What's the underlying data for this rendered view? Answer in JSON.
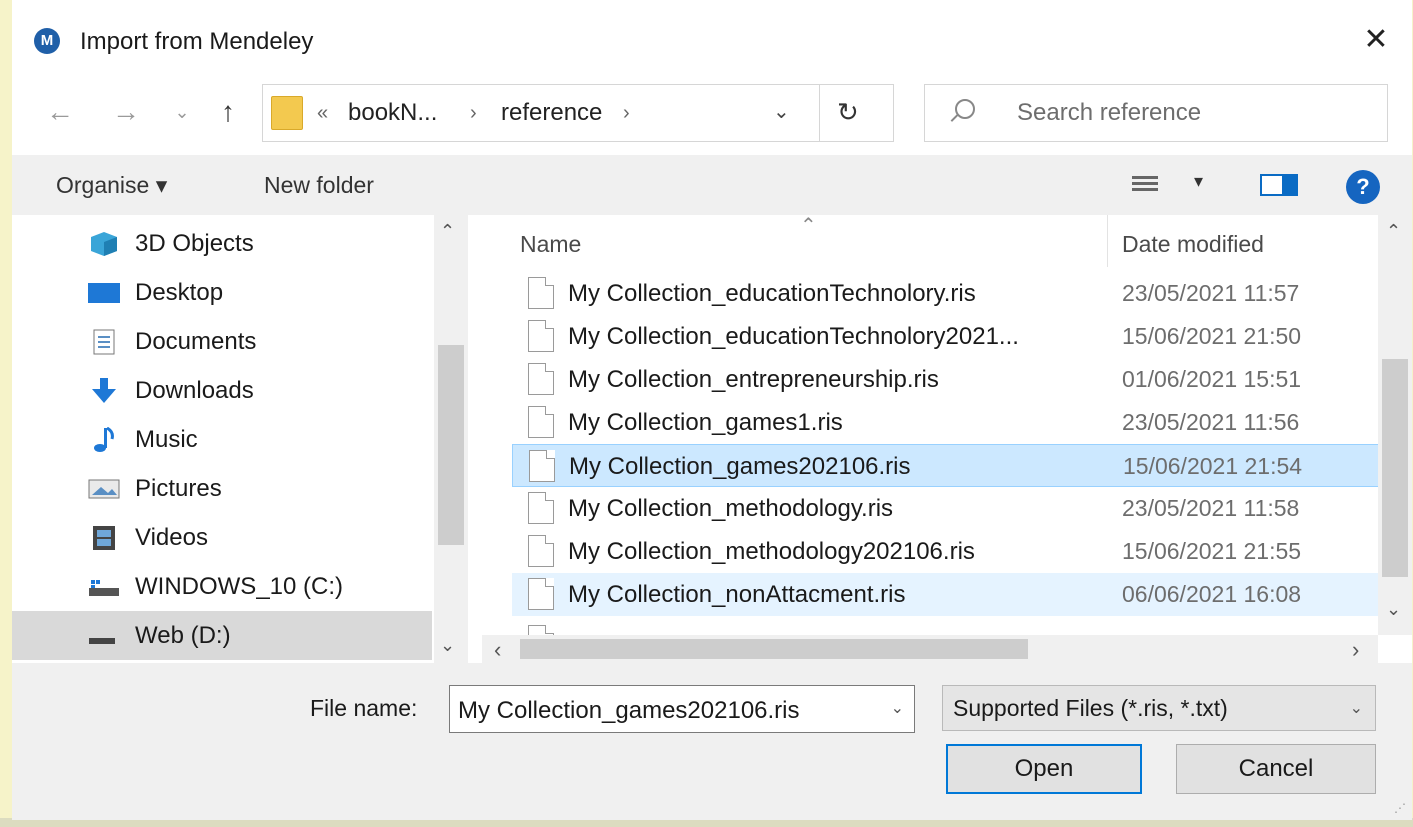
{
  "dialog": {
    "title": "Import from Mendeley",
    "close_glyph": "✕"
  },
  "nav": {
    "back_glyph": "←",
    "forward_glyph": "→",
    "recent_glyph": "⌄",
    "up_glyph": "↑",
    "breadcrumb": [
      {
        "label": "bookN..."
      },
      {
        "label": "reference"
      }
    ],
    "overflow_glyph": "«",
    "sep_glyph": "›",
    "dropdown_glyph": "⌄",
    "refresh_glyph": "↻",
    "search_placeholder": "Search reference"
  },
  "toolbar": {
    "organise_label": "Organise ▾",
    "new_folder_label": "New folder",
    "view_dropdown_glyph": "▾",
    "help_glyph": "?"
  },
  "sidebar": {
    "items": [
      {
        "label": "3D Objects",
        "icon": "3d-objects-icon"
      },
      {
        "label": "Desktop",
        "icon": "desktop-icon"
      },
      {
        "label": "Documents",
        "icon": "documents-icon"
      },
      {
        "label": "Downloads",
        "icon": "downloads-icon"
      },
      {
        "label": "Music",
        "icon": "music-icon"
      },
      {
        "label": "Pictures",
        "icon": "pictures-icon"
      },
      {
        "label": "Videos",
        "icon": "videos-icon"
      },
      {
        "label": "WINDOWS_10 (C:)",
        "icon": "drive-icon"
      },
      {
        "label": "Web (D:)",
        "icon": "drive-icon"
      }
    ],
    "selected_index": 8,
    "scroll_up_glyph": "⌃",
    "scroll_down_glyph": "⌄"
  },
  "file_list": {
    "columns": {
      "name": "Name",
      "date": "Date modified"
    },
    "sort_glyph": "⌃",
    "files": [
      {
        "name": "My Collection_educationTechnolory.ris",
        "date": "23/05/2021 11:57"
      },
      {
        "name": "My Collection_educationTechnolory2021...",
        "date": "15/06/2021 21:50"
      },
      {
        "name": "My Collection_entrepreneurship.ris",
        "date": "01/06/2021 15:51"
      },
      {
        "name": "My Collection_games1.ris",
        "date": "23/05/2021 11:56"
      },
      {
        "name": "My Collection_games202106.ris",
        "date": "15/06/2021 21:54"
      },
      {
        "name": "My Collection_methodology.ris",
        "date": "23/05/2021 11:58"
      },
      {
        "name": "My Collection_methodology202106.ris",
        "date": "15/06/2021 21:55"
      },
      {
        "name": "My Collection_nonAttacment.ris",
        "date": "06/06/2021 16:08"
      }
    ],
    "selected_index": 4,
    "hover_index": 7,
    "scroll_up_glyph": "⌃",
    "scroll_down_glyph": "⌄",
    "scroll_left_glyph": "‹",
    "scroll_right_glyph": "›"
  },
  "bottom": {
    "file_name_label": "File name:",
    "file_name_value": "My Collection_games202106.ris",
    "file_type_value": "Supported Files (*.ris, *.txt)",
    "dropdown_glyph": "⌄",
    "open_label": "Open",
    "cancel_label": "Cancel"
  },
  "colors": {
    "background": "#f6f3c9",
    "selection": "#cce8ff",
    "accent": "#0078d7"
  }
}
